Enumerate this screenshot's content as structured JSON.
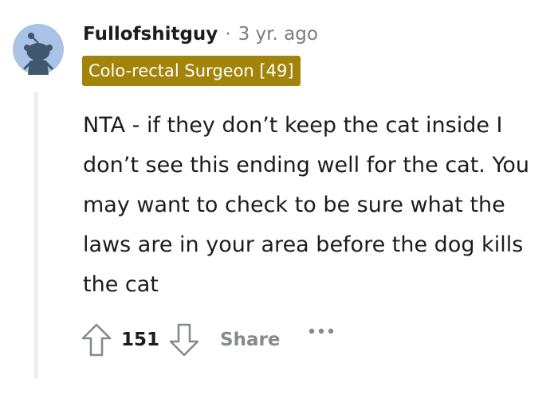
{
  "comment": {
    "username": "Fullofshitguy",
    "separator": "·",
    "time": "3 yr. ago",
    "flair": "Colo-rectal Surgeon [49]",
    "body": "NTA - if they don’t keep the cat inside I don’t see this ending well for the cat. You may want to check to be sure what the laws are in your area before the dog kills the cat",
    "score": "151",
    "share_label": "Share"
  },
  "colors": {
    "flair_background": "#a2840a",
    "avatar_background": "#a8c3e6",
    "muted_text": "#7c7c7c",
    "action_gray": "#878a8c"
  },
  "icons": {
    "avatar": "snoo-avatar-icon",
    "upvote": "upvote-arrow-icon",
    "downvote": "downvote-arrow-icon",
    "more": "more-options-icon"
  }
}
